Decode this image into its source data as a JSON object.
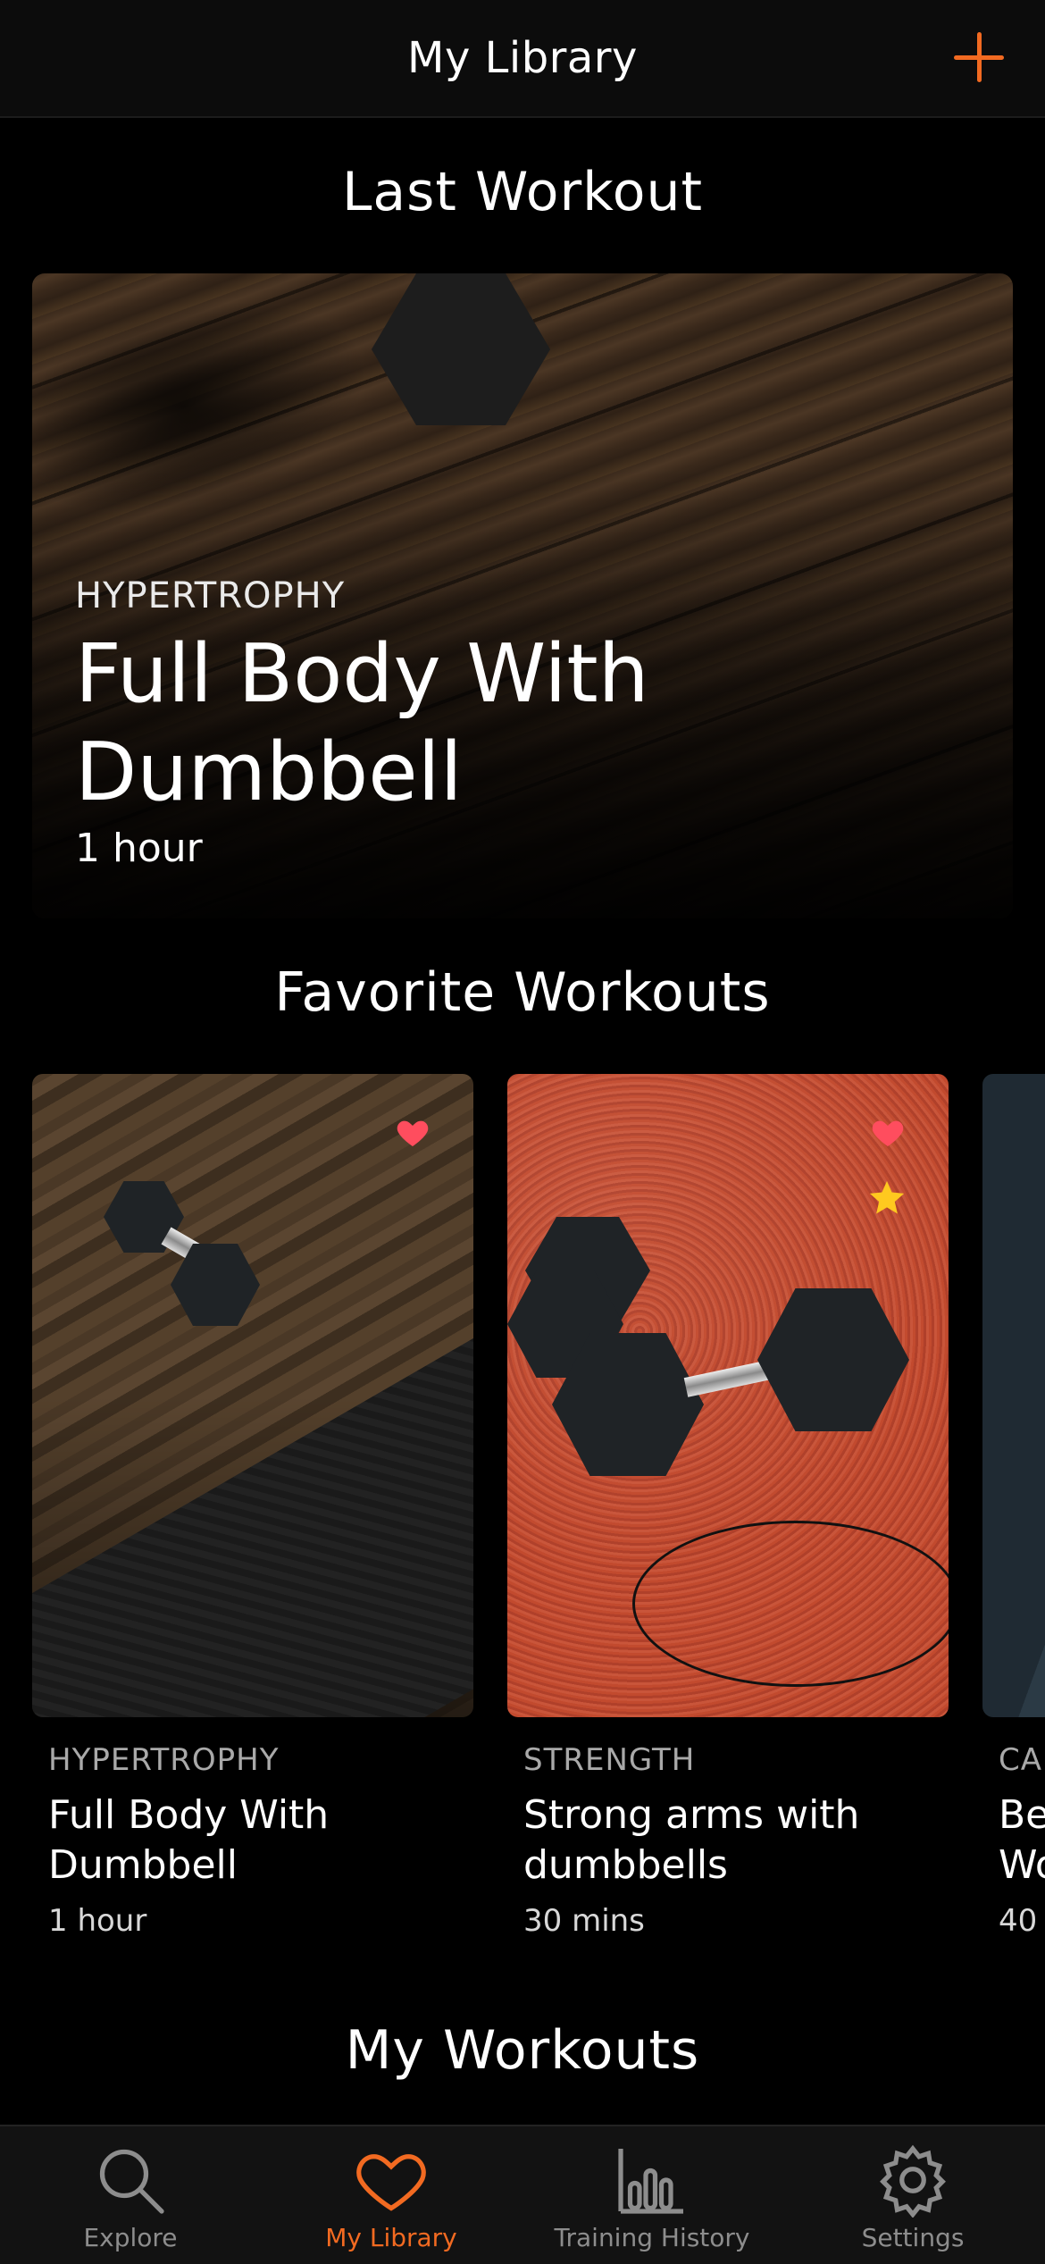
{
  "header": {
    "title": "My Library",
    "add_icon": "plus-icon"
  },
  "last_workout": {
    "section_title": "Last Workout",
    "category": "HYPERTROPHY",
    "name": "Full Body With Dumbbell",
    "duration": "1 hour"
  },
  "favorites": {
    "section_title": "Favorite Workouts",
    "items": [
      {
        "category": "HYPERTROPHY",
        "name": "Full Body With Dumbbell",
        "duration": "1 hour",
        "favorited": true,
        "starred": false
      },
      {
        "category": "STRENGTH",
        "name": "Strong arms with dumbbells",
        "duration": "30 mins",
        "favorited": true,
        "starred": true
      },
      {
        "category": "CA",
        "name": "Be",
        "name2": "Wo",
        "duration": "40"
      }
    ]
  },
  "my_workouts": {
    "section_title": "My Workouts"
  },
  "tabbar": {
    "items": [
      {
        "label": "Explore",
        "icon": "search-icon"
      },
      {
        "label": "My Library",
        "icon": "heart-icon",
        "active": true
      },
      {
        "label": "Training History",
        "icon": "bar-chart-icon"
      },
      {
        "label": "Settings",
        "icon": "gear-icon"
      }
    ]
  },
  "colors": {
    "accent": "#f26a21",
    "heart": "#ff4d5e",
    "star": "#ffc91f"
  }
}
